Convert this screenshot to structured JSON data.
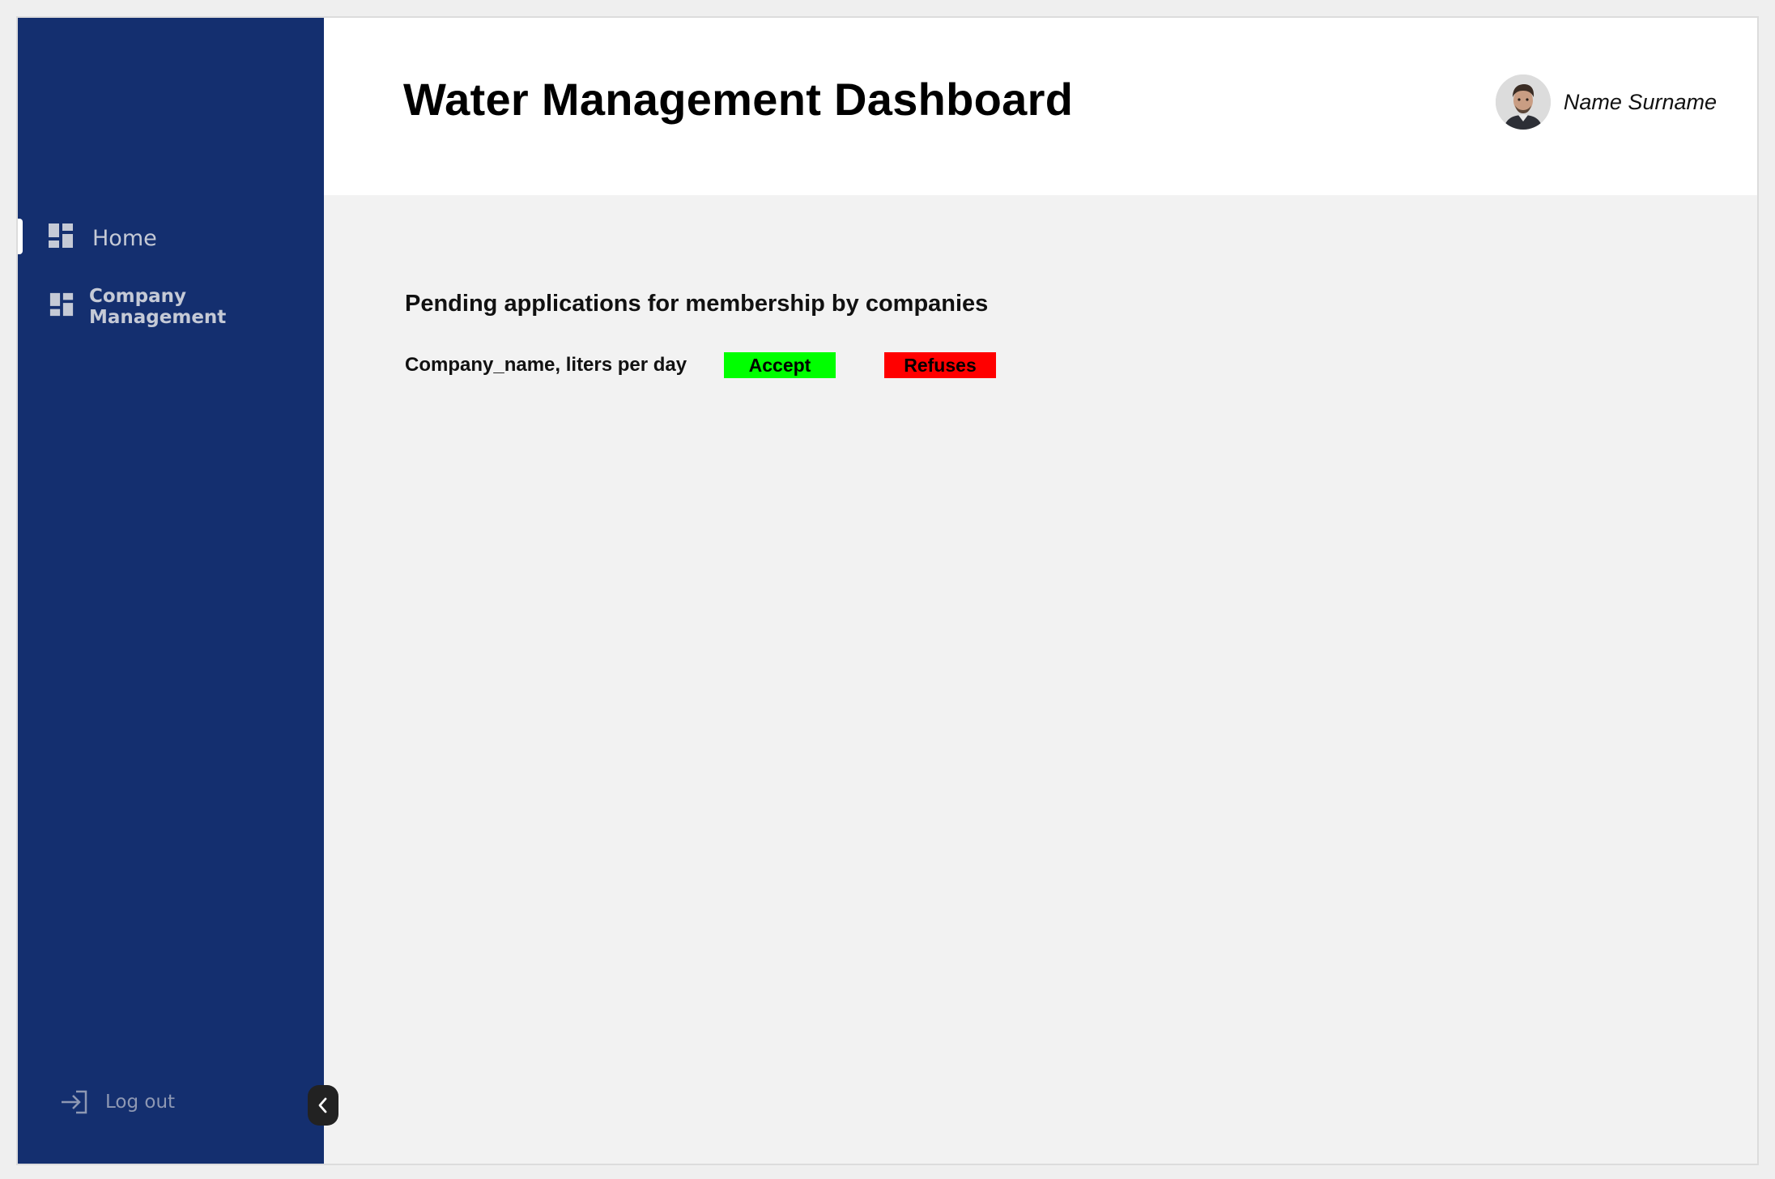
{
  "app": {
    "title": "Water Management Dashboard"
  },
  "user": {
    "name": "Name Surname",
    "avatar_icon": "user-avatar-photo"
  },
  "sidebar": {
    "background": "#142f6f",
    "items": [
      {
        "label": "Home",
        "icon": "dashboard-icon",
        "active": true
      },
      {
        "label": "Company Management",
        "icon": "dashboard-icon",
        "active": false
      }
    ],
    "logout_label": "Log out",
    "logout_icon": "logout-icon",
    "collapse_icon": "chevron-left-icon"
  },
  "main": {
    "section_title": "Pending applications for membership by companies",
    "applications": [
      {
        "label": "Company_name, liters per day",
        "accept_label": "Accept",
        "refuse_label": "Refuses"
      }
    ]
  },
  "colors": {
    "accept": "#00ff00",
    "refuse": "#ff0000",
    "sidebar": "#142f6f"
  }
}
